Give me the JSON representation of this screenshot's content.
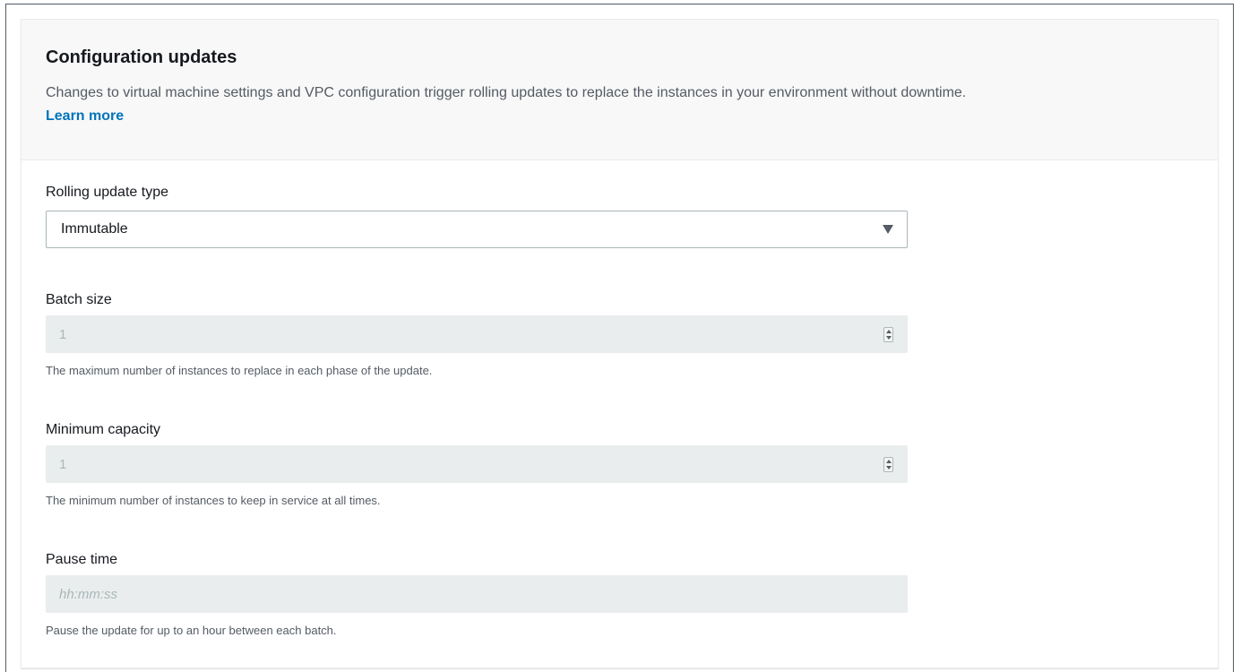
{
  "section": {
    "title": "Configuration updates",
    "description": "Changes to virtual machine settings and VPC configuration trigger rolling updates to replace the instances in your environment without downtime.",
    "learn_more": "Learn more"
  },
  "rolling_update_type": {
    "label": "Rolling update type",
    "selected": "Immutable",
    "caret_icon": "caret-down-icon"
  },
  "batch_size": {
    "label": "Batch size",
    "value": "1",
    "help": "The maximum number of instances to replace in each phase of the update."
  },
  "minimum_capacity": {
    "label": "Minimum capacity",
    "value": "1",
    "help": "The minimum number of instances to keep in service at all times."
  },
  "pause_time": {
    "label": "Pause time",
    "placeholder": "hh:mm:ss",
    "help": "Pause the update for up to an hour between each batch."
  },
  "colors": {
    "link": "#0073bb",
    "header_bg": "#f8f8f8",
    "disabled_input_bg": "#eaeded",
    "text": "#16191f",
    "muted_text": "#545b64"
  }
}
